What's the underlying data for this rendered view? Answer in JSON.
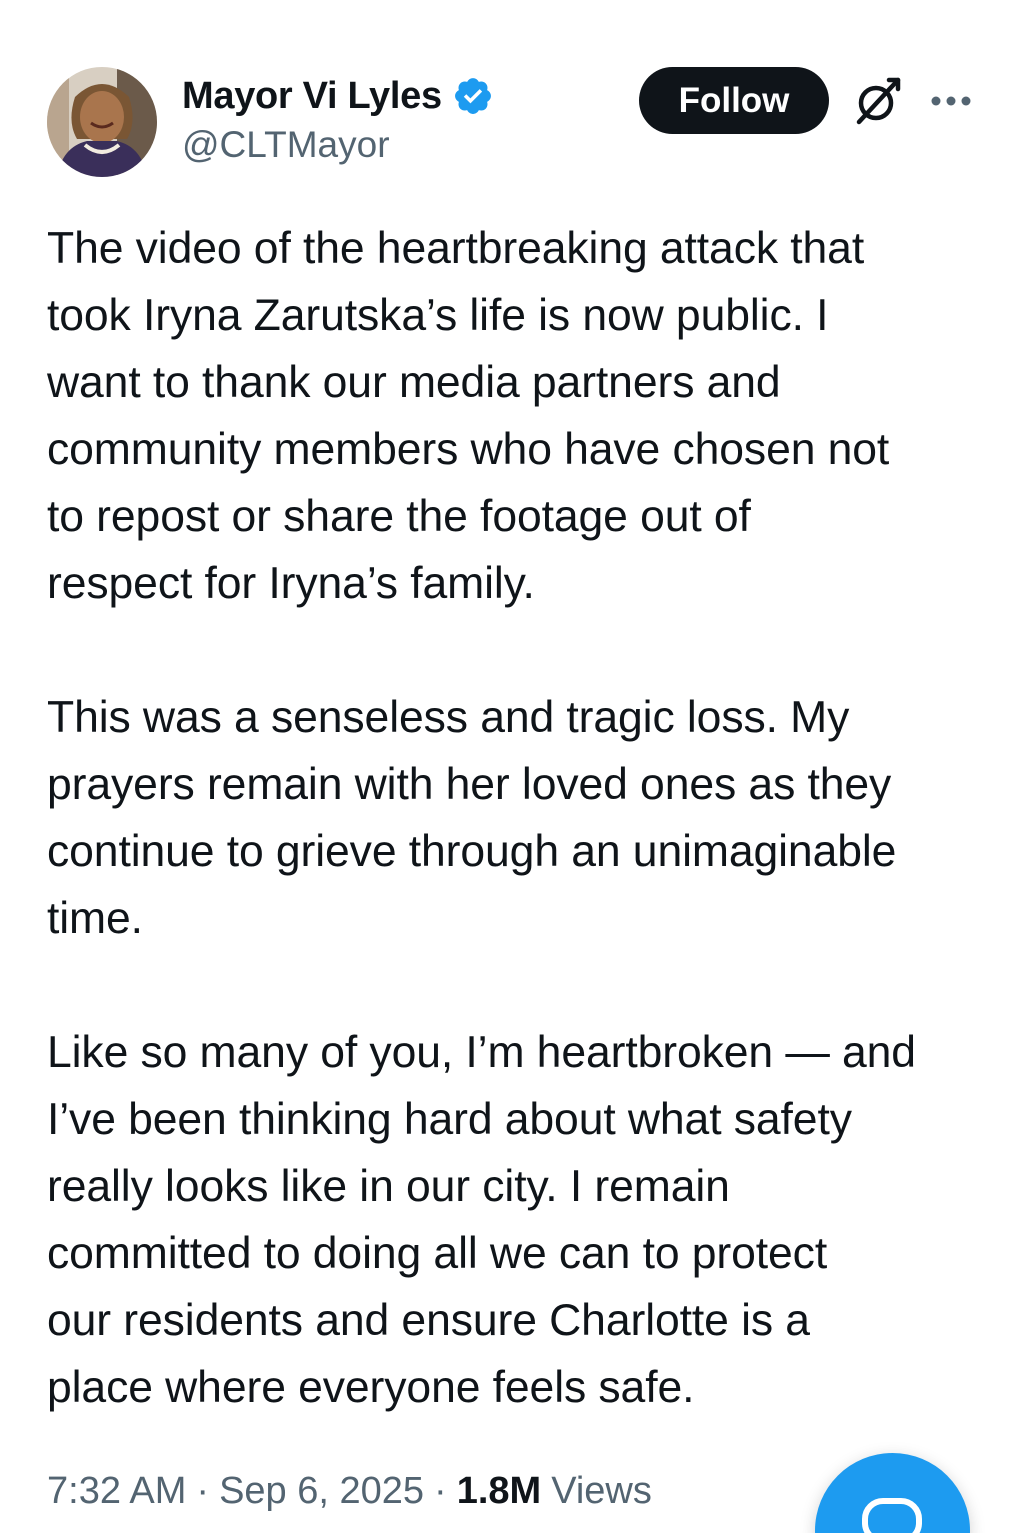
{
  "author": {
    "display_name": "Mayor Vi Lyles",
    "handle": "@CLTMayor",
    "verified_icon": "verified-badge-icon",
    "avatar_icon": "profile-photo"
  },
  "actions": {
    "follow_label": "Follow",
    "grok_icon": "grok-icon",
    "more_icon": "more-dots-icon"
  },
  "tweet": {
    "paragraphs": [
      {
        "lines": [
          "The video of the heartbreaking attack that",
          "took Iryna Zarutska’s life is now public. I",
          "want to thank our media partners and",
          "community members who have chosen not",
          "to repost or share the footage out of",
          "respect for Iryna’s family."
        ]
      },
      {
        "lines": [
          "This was a senseless and tragic loss. My",
          "prayers remain with her loved ones as they",
          "continue to grieve through an unimaginable",
          "time."
        ]
      },
      {
        "lines": [
          "Like so many of you, I’m heartbroken — and",
          "I’ve been thinking hard about what safety",
          "really looks like in our city. I remain",
          "committed to doing all we can to protect",
          "our residents and ensure Charlotte is a",
          "place where everyone feels safe."
        ]
      }
    ]
  },
  "meta": {
    "time": "7:32 AM",
    "separator": "·",
    "date": "Sep 6, 2025",
    "views_count": "1.8M",
    "views_label": "Views"
  },
  "fab": {
    "icon": "compose-icon"
  },
  "colors": {
    "text_primary": "#0f1419",
    "text_secondary": "#536471",
    "verified_blue": "#1d9bf0",
    "follow_bg": "#0f1419",
    "follow_text": "#ffffff",
    "fab_bg": "#1d9bf0"
  }
}
